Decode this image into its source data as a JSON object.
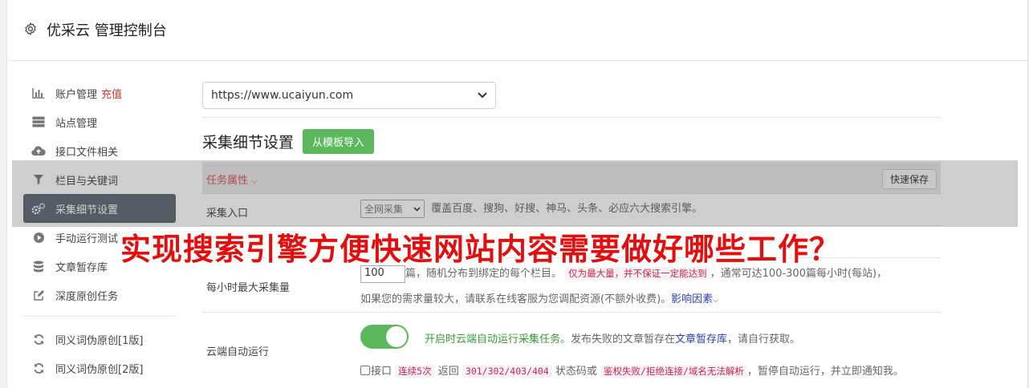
{
  "header": {
    "title": "优采云 管理控制台",
    "icon": "gear-icon"
  },
  "sidebar": {
    "items": [
      {
        "label": "账户管理",
        "badge": "充值",
        "icon": "bar-chart-icon"
      },
      {
        "label": "站点管理",
        "icon": "server-icon"
      },
      {
        "label": "接口文件相关",
        "icon": "cloud-upload-icon"
      },
      {
        "label": "栏目与关键词",
        "icon": "filter-icon"
      },
      {
        "label": "采集细节设置",
        "icon": "gears-icon",
        "active": true
      },
      {
        "label": "手动运行测试",
        "icon": "play-circle-icon"
      },
      {
        "label": "文章暂存库",
        "icon": "database-icon"
      },
      {
        "label": "深度原创任务",
        "icon": "edit-icon"
      }
    ],
    "items2": [
      {
        "label": "同义词伪原创[1版]",
        "icon": "refresh-icon"
      },
      {
        "label": "同义词伪原创[2版]",
        "icon": "refresh-icon"
      }
    ]
  },
  "main": {
    "site_select": "https://www.ucaiyun.com",
    "section_title": "采集细节设置",
    "import_button": "从模板导入",
    "task_attr": "任务属性",
    "quick_save": "快速保存",
    "entry": {
      "label": "采集入口",
      "select_value": "全网采集",
      "desc": "覆盖百度、搜狗、好搜、神马、头条、必应六大搜索引擎。"
    },
    "max_per_hour": {
      "label": "每小时最大采集量",
      "value": "100",
      "unit_text": "篇，随机分布到绑定的每个栏目。",
      "highlight": "仅为最大量，并不保证一定能达到",
      "after_highlight": "，通常可达100-300篇每小时(每站)，",
      "line2": "如果您的需求量较大，请联系在线客服为您调配资源(不额外收费)。",
      "link": "影响因素"
    },
    "cloud_run": {
      "label": "云端自动运行",
      "enabled_text": "开启时云端自动运行采集任务。",
      "fail_text": "发布失败的文章暂存在",
      "fail_link": "文章暂存库",
      "fail_after": "，请自行获取。",
      "check_prefix": "接口",
      "code1": "连续5次",
      "mid1": "返回",
      "code2": "301/302/403/404",
      "mid2": "状态码或",
      "code3": "鉴权失败/拒绝连接/域名无法解析",
      "suffix": "，暂停自动运行，并立即通知我。"
    }
  },
  "headline": "实现搜索引擎方便快速网站内容需要做好哪些工作？"
}
